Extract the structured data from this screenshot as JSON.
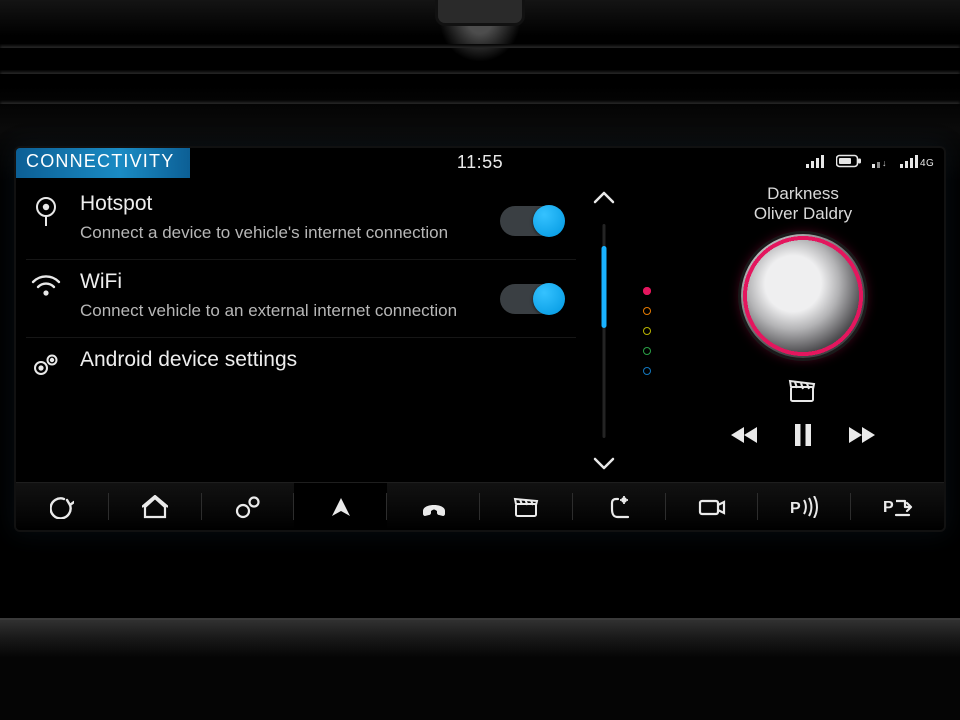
{
  "header": {
    "title": "CONNECTIVITY",
    "clock": "11:55",
    "signal_4g_label": "4G"
  },
  "settings": {
    "items": [
      {
        "icon": "hotspot-icon",
        "title": "Hotspot",
        "subtitle": "Connect a device to vehicle's internet connection",
        "toggle_on": true
      },
      {
        "icon": "wifi-icon",
        "title": "WiFi",
        "subtitle": "Connect  vehicle to an external internet connection",
        "toggle_on": true
      },
      {
        "icon": "gears-icon",
        "title": "Android device settings",
        "subtitle": "",
        "toggle_on": null
      }
    ]
  },
  "page_dots": {
    "colors": [
      "#e4165e",
      "#e67a00",
      "#b9b400",
      "#2aa046",
      "#1277c0"
    ],
    "active_index": 0
  },
  "media": {
    "track": "Darkness",
    "artist": "Oliver Daldry",
    "source_icon": "clapper-icon",
    "controls": [
      "prev-icon",
      "pause-icon",
      "next-icon"
    ]
  },
  "nav": {
    "items": [
      {
        "name": "back-icon"
      },
      {
        "name": "home-icon"
      },
      {
        "name": "settings-icon"
      },
      {
        "name": "navigate-icon",
        "active": true
      },
      {
        "name": "phone-icon"
      },
      {
        "name": "media-icon"
      },
      {
        "name": "seat-climate-icon"
      },
      {
        "name": "camera-icon"
      },
      {
        "name": "park-sensor-icon"
      },
      {
        "name": "park-assist-icon"
      }
    ],
    "park_label": "P"
  }
}
